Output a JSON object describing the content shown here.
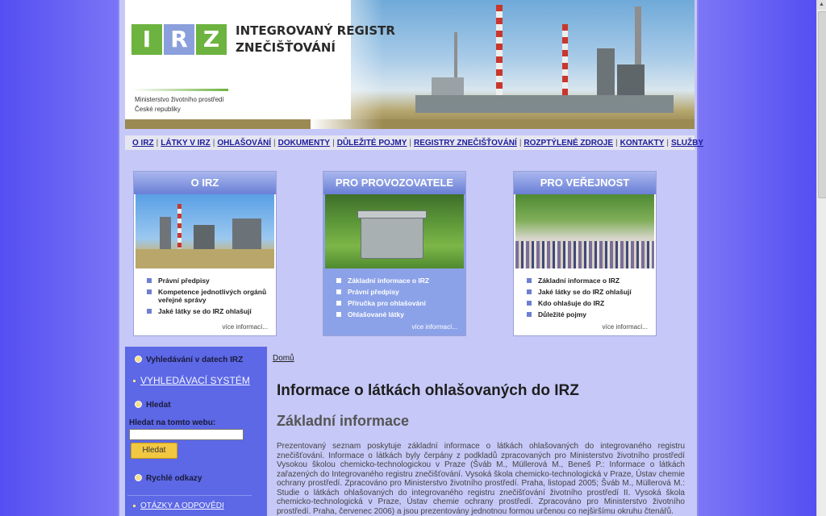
{
  "header": {
    "logo_letters": [
      "I",
      "R",
      "Z"
    ],
    "title_line1": "INTEGROVANÝ REGISTR",
    "title_line2": "ZNEČIŠŤOVÁNÍ",
    "ministry_line1": "Ministerstvo životního prostředí",
    "ministry_line2": "České republiky"
  },
  "nav": [
    "O IRZ",
    "LÁTKY V IRZ",
    "OHLAŠOVÁNÍ",
    "DOKUMENTY",
    "DŮLEŽITÉ POJMY",
    "REGISTRY ZNEČIŠŤOVÁNÍ",
    "ROZPTÝLENÉ ZDROJE",
    "KONTAKTY",
    "SLUŽBY"
  ],
  "cards": [
    {
      "title": "O IRZ",
      "items": [
        "Právní předpisy",
        "Kompetence jednotlivých orgánů veřejné správy",
        "Jaké látky se do IRZ ohlašují"
      ],
      "more": "více informací..."
    },
    {
      "title": "PRO PROVOZOVATELE",
      "items": [
        "Základní informace o IRZ",
        "Právní předpisy",
        "Příručka pro ohlašování",
        "Ohlašované látky"
      ],
      "more": "více informací..."
    },
    {
      "title": "PRO VEŘEJNOST",
      "items": [
        "Základní informace o IRZ",
        "Jaké látky se do IRZ ohlašují",
        "Kdo ohlašuje do IRZ",
        "Důležité pojmy"
      ],
      "more": "více informací..."
    }
  ],
  "sidebar": {
    "data_heading": "Vyhledávání v datech IRZ",
    "data_link": "VYHLEDÁVACÍ SYSTÉM",
    "search_heading": "Hledat",
    "search_label": "Hledat na tomto webu:",
    "search_value": "",
    "search_button": "Hledat",
    "quick_heading": "Rychlé odkazy",
    "faq_link": "OTÁZKY A ODPOVĚDI"
  },
  "content": {
    "breadcrumb": "Domů",
    "title": "Informace o látkách ohlašovaných do IRZ",
    "subtitle": "Základní informace",
    "text": "Prezentovaný seznam poskytuje základní informace o látkách ohlašovaných do integrovaného registru znečišťování. Informace o látkách byly čerpány z podkladů zpracovaných pro Ministerstvo životního prostředí Vysokou školou chemicko-technologickou v Praze (Šváb M., Müllerová M., Beneš P.: Informace o látkách zařazených do Integrovaného registru znečišťování. Vysoká škola chemicko-technologická v Praze, Ústav chemie ochrany prostředí. Zpracováno pro Ministerstvo životního prostředí. Praha, listopad 2005; Šváb M., Müllerová M.: Studie o látkách ohlašovaných do integrovaného registru znečišťování životního prostředí II. Vysoká škola chemicko-technologická v Praze, Ústav chemie ochrany prostředí. Zpracováno pro Ministerstvo životního prostředí. Praha, červenec 2006) a jsou prezentovány jednotnou formou určenou co nejširšímu okruhu čtenářů."
  },
  "colors": {
    "page_bg": "#6a62f4",
    "content_bg": "#c6c8f7",
    "sidebar_bg": "#5c68e6",
    "logo_green": "#6db33f",
    "logo_blue": "#8b9fdc",
    "nav_link": "#1b1b9a",
    "button_yellow": "#f2c843"
  }
}
